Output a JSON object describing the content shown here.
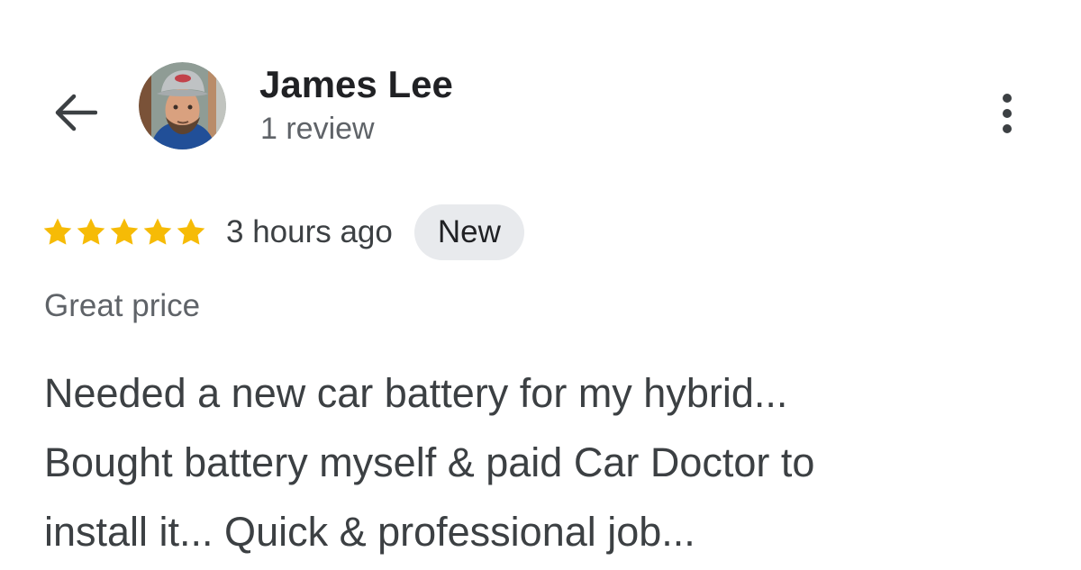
{
  "header": {
    "back_icon": "arrow-back-icon",
    "avatar_icon": "reviewer-avatar",
    "reviewer_name": "James Lee",
    "review_count": "1 review",
    "more_icon": "more-vertical-icon"
  },
  "review": {
    "rating": 5,
    "rating_max": 5,
    "star_color": "#f6bb06",
    "time_ago": "3 hours ago",
    "badge": "New",
    "highlight": "Great price",
    "text_lines": [
      "Needed a new car battery for my hybrid...",
      "Bought battery myself & paid Car Doctor to",
      "install it... Quick & professional job..."
    ]
  },
  "colors": {
    "background": "#ffffff",
    "primary_text": "#202124",
    "secondary_text": "#5f6368",
    "badge_background": "#e8eaed"
  }
}
